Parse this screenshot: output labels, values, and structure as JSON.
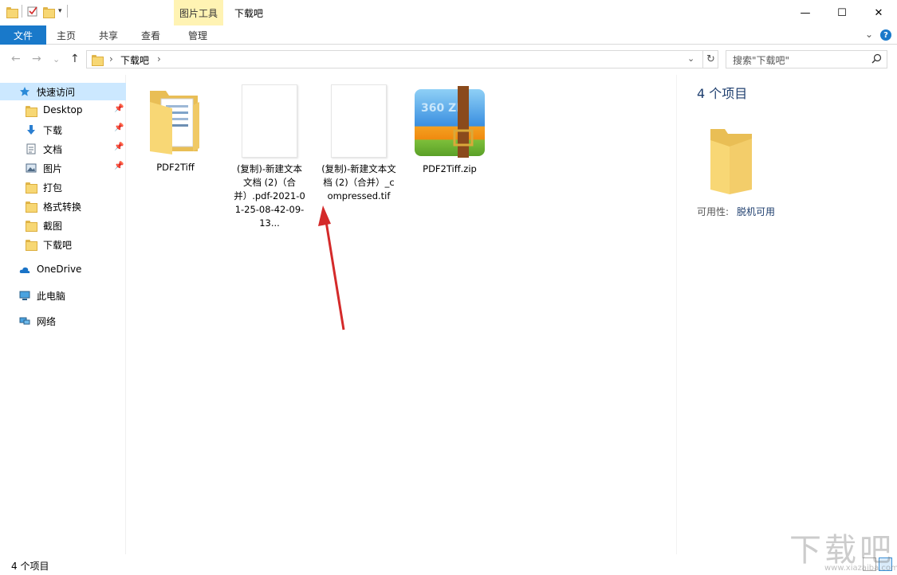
{
  "titlebar": {
    "context_tab_title": "图片工具",
    "window_title": "下载吧",
    "minimize_glyph": "—",
    "maximize_glyph": "☐",
    "close_glyph": "✕"
  },
  "ribbon": {
    "tabs": [
      {
        "label": "文件"
      },
      {
        "label": "主页"
      },
      {
        "label": "共享"
      },
      {
        "label": "查看"
      },
      {
        "label": "管理"
      }
    ],
    "expand_glyph": "⌄",
    "help_glyph": "?"
  },
  "address": {
    "back_glyph": "←",
    "forward_glyph": "→",
    "recent_glyph": "⌄",
    "up_glyph": "↑",
    "path": "下载吧",
    "sep_glyph": "›",
    "dropdown_glyph": "⌄",
    "refresh_glyph": "↻"
  },
  "search": {
    "placeholder": "搜索\"下载吧\"",
    "icon": "search-icon"
  },
  "nav": {
    "quick_access": "快速访问",
    "quick_items": [
      {
        "label": "Desktop",
        "icon": "folder-icon"
      },
      {
        "label": "下载",
        "icon": "download-icon"
      },
      {
        "label": "文档",
        "icon": "document-icon"
      },
      {
        "label": "图片",
        "icon": "pictures-icon"
      },
      {
        "label": "打包",
        "icon": "folder-icon"
      },
      {
        "label": "格式转换",
        "icon": "folder-icon"
      },
      {
        "label": "截图",
        "icon": "folder-icon"
      },
      {
        "label": "下载吧",
        "icon": "folder-icon"
      }
    ],
    "onedrive": "OneDrive",
    "this_pc": "此电脑",
    "network": "网络"
  },
  "files": [
    {
      "label": "PDF2Tiff",
      "type": "folder"
    },
    {
      "label": "(复制)-新建文本文档 (2)（合并）.pdf-2021-01-25-08-42-09-13...",
      "type": "document"
    },
    {
      "label": "(复制)-新建文本文档 (2)（合并）_compressed.tif",
      "type": "document"
    },
    {
      "label": "PDF2Tiff.zip",
      "type": "archive"
    }
  ],
  "archive_icon_text": "360 ZIP",
  "details": {
    "count": "4 个项目",
    "availability_label": "可用性:",
    "availability_value": "脱机可用"
  },
  "status": {
    "count": "4 个项目"
  },
  "watermark": {
    "text": "下载吧",
    "sub": "www.xiazaiba.com"
  },
  "colors": {
    "accent": "#1979ca",
    "context_tab": "#fff3b3",
    "selection": "#cce8ff",
    "folder": "#f7d774",
    "arrow": "#d42a2a"
  }
}
